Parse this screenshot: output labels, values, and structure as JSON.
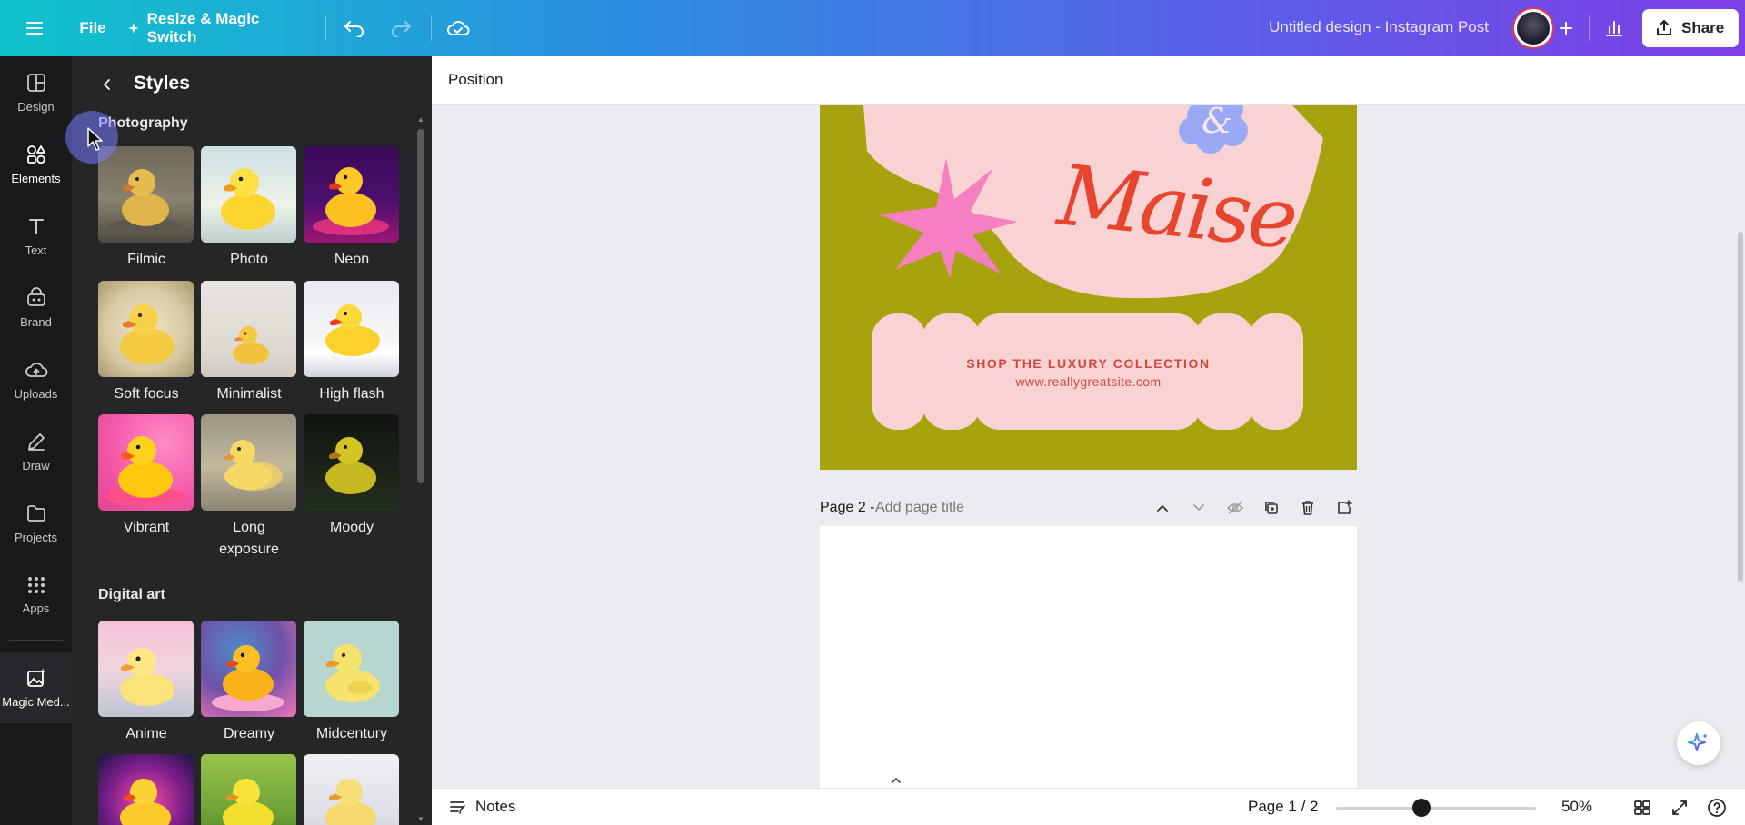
{
  "topbar": {
    "file": "File",
    "resize": "Resize & Magic Switch",
    "title": "Untitled design - Instagram Post",
    "share": "Share"
  },
  "rail": {
    "items": [
      {
        "label": "Design",
        "icon": "design-icon"
      },
      {
        "label": "Elements",
        "icon": "elements-icon"
      },
      {
        "label": "Text",
        "icon": "text-icon"
      },
      {
        "label": "Brand",
        "icon": "brand-icon"
      },
      {
        "label": "Uploads",
        "icon": "uploads-icon"
      },
      {
        "label": "Draw",
        "icon": "draw-icon"
      },
      {
        "label": "Projects",
        "icon": "projects-icon"
      },
      {
        "label": "Apps",
        "icon": "apps-icon"
      },
      {
        "label": "Magic Med...",
        "icon": "magic-media-icon"
      }
    ]
  },
  "panel": {
    "title": "Styles",
    "sections": [
      {
        "title": "Photography",
        "styles": [
          "Filmic",
          "Photo",
          "Neon",
          "Soft focus",
          "Minimalist",
          "High flash",
          "Vibrant",
          "Long exposure",
          "Moody"
        ]
      },
      {
        "title": "Digital art",
        "styles": [
          "Anime",
          "Dreamy",
          "Midcentury"
        ]
      }
    ]
  },
  "toolbar": {
    "position": "Position"
  },
  "canvas": {
    "brand": "Maise",
    "cta_title": "SHOP THE LUXURY COLLECTION",
    "cta_url": "www.reallygreatsite.com",
    "page2_label": "Page 2 - ",
    "page2_placeholder": "Add page title",
    "colors": {
      "page_bg": "#a6a30e",
      "pink": "#f9d2d4",
      "star": "#f57fc0",
      "accent": "#e8452f",
      "flower": "#9aa9f5"
    }
  },
  "footer": {
    "notes": "Notes",
    "page": "Page 1 / 2",
    "zoom": "50%"
  }
}
